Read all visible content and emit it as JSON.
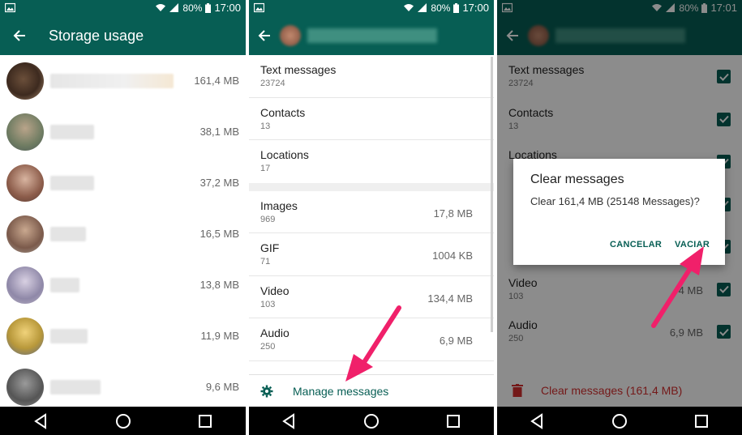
{
  "status": {
    "s1_battery": "80%",
    "s1_time": "17:00",
    "s2_battery": "80%",
    "s2_time": "17:00",
    "s3_battery": "80%",
    "s3_time": "17:01"
  },
  "screen1": {
    "title": "Storage usage",
    "rows": [
      {
        "size": "161,4 MB"
      },
      {
        "size": "38,1 MB"
      },
      {
        "size": "37,2 MB"
      },
      {
        "size": "16,5 MB"
      },
      {
        "size": "13,8 MB"
      },
      {
        "size": "11,9 MB"
      },
      {
        "size": "9,6 MB"
      }
    ]
  },
  "screen2": {
    "items_top": [
      {
        "label": "Text messages",
        "count": "23724"
      },
      {
        "label": "Contacts",
        "count": "13"
      },
      {
        "label": "Locations",
        "count": "17"
      }
    ],
    "items_media": [
      {
        "label": "Images",
        "count": "969",
        "size": "17,8 MB"
      },
      {
        "label": "GIF",
        "count": "71",
        "size": "1004 KB"
      },
      {
        "label": "Video",
        "count": "103",
        "size": "134,4 MB"
      },
      {
        "label": "Audio",
        "count": "250",
        "size": "6,9 MB"
      }
    ],
    "manage_label": "Manage messages"
  },
  "screen3": {
    "items": [
      {
        "label": "Text messages",
        "count": "23724"
      },
      {
        "label": "Contacts",
        "count": "13"
      },
      {
        "label": "Locations",
        "count": ""
      },
      {
        "label": "",
        "count": ""
      },
      {
        "label": "",
        "count": ""
      },
      {
        "label": "Video",
        "count": "103",
        "size": "4 MB"
      },
      {
        "label": "Audio",
        "count": "250",
        "size": "6,9 MB"
      }
    ],
    "clear_label": "Clear messages (161,4 MB)",
    "dialog": {
      "title": "Clear messages",
      "message": "Clear 161,4 MB (25148 Messages)?",
      "cancel": "CANCELAR",
      "confirm": "VACIAR"
    }
  },
  "colors": {
    "brand": "#075e54",
    "accent_arrow": "#f0206a",
    "danger": "#d32f2f"
  },
  "icons": [
    "back-arrow-icon",
    "gear-icon",
    "trash-icon",
    "checkbox-icon",
    "wifi-icon",
    "signal-icon",
    "battery-icon",
    "gallery-icon",
    "nav-back-icon",
    "nav-home-icon",
    "nav-recents-icon"
  ]
}
